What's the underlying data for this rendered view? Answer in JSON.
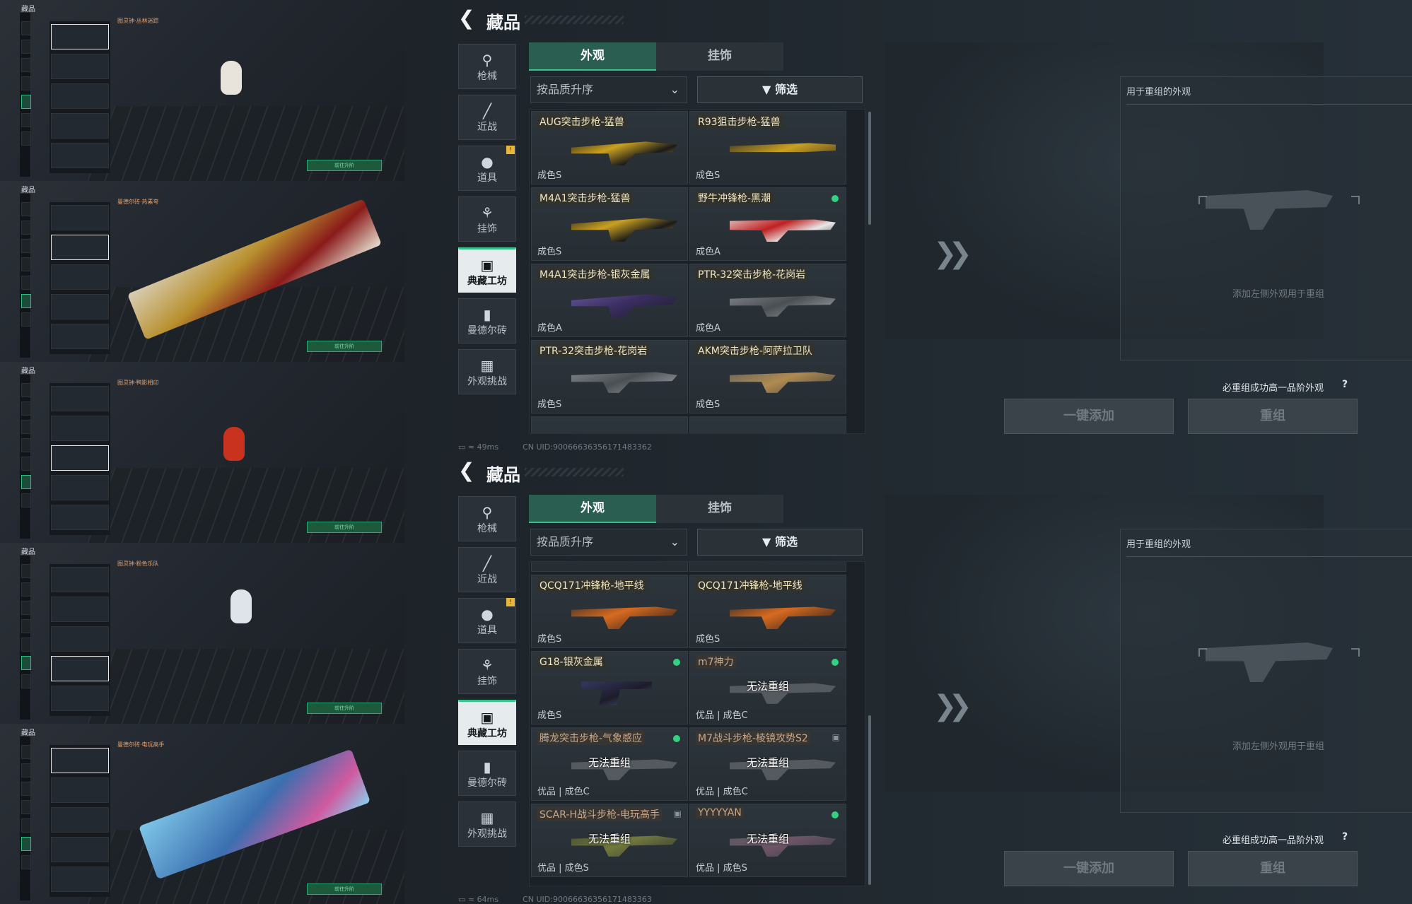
{
  "thumbs": [
    {
      "header": "藏品",
      "title": "图灵钟·丛林迷踪",
      "go": "前往升阶"
    },
    {
      "header": "藏品",
      "title": "曼德尔砖·热素夸",
      "go": "前往升阶"
    },
    {
      "header": "藏品",
      "title": "图灵钟·鸭影相印",
      "go": "前往升阶"
    },
    {
      "header": "藏品",
      "title": "图灵钟·粉色乐队",
      "go": "前往升阶"
    },
    {
      "header": "藏品",
      "title": "曼德尔砖·电玩高手",
      "go": "前往升阶"
    }
  ],
  "screens": [
    {
      "title": "藏品",
      "categories": [
        "枪械",
        "近战",
        "道具",
        "挂饰",
        "典藏工坊",
        "曼德尔砖",
        "外观挑战"
      ],
      "active_category": "典藏工坊",
      "tabs": [
        "外观",
        "挂饰"
      ],
      "sort_label": "按品质升序",
      "filter_label": "筛选",
      "items": [
        {
          "name": "AUG突击步枪-猛兽",
          "grade": "成色S",
          "dot": false,
          "lock": false,
          "unavailable": ""
        },
        {
          "name": "R93狙击步枪-猛兽",
          "grade": "成色S",
          "dot": false,
          "lock": false,
          "unavailable": ""
        },
        {
          "name": "M4A1突击步枪-猛兽",
          "grade": "成色S",
          "dot": false,
          "lock": false,
          "unavailable": ""
        },
        {
          "name": "野牛冲锋枪-黑潮",
          "grade": "成色A",
          "dot": true,
          "lock": false,
          "unavailable": ""
        },
        {
          "name": "M4A1突击步枪-银灰金属",
          "grade": "成色A",
          "dot": false,
          "lock": false,
          "unavailable": ""
        },
        {
          "name": "PTR-32突击步枪-花岗岩",
          "grade": "成色A",
          "dot": false,
          "lock": false,
          "unavailable": ""
        },
        {
          "name": "PTR-32突击步枪-花岗岩",
          "grade": "成色S",
          "dot": false,
          "lock": false,
          "unavailable": ""
        },
        {
          "name": "AKM突击步枪-阿萨拉卫队",
          "grade": "成色S",
          "dot": false,
          "lock": false,
          "unavailable": ""
        }
      ],
      "recombine_header": "用于重组的外观",
      "recombine_placeholder": "添加左侧外观用于重组",
      "hint": "必重组成功高一品阶外观",
      "hint_q": "?",
      "btn_add": "一键添加",
      "btn_recombine": "重组",
      "ping": "49ms",
      "uid": "CN UID:9006663635617148336​2"
    },
    {
      "title": "藏品",
      "categories": [
        "枪械",
        "近战",
        "道具",
        "挂饰",
        "典藏工坊",
        "曼德尔砖",
        "外观挑战"
      ],
      "active_category": "典藏工坊",
      "tabs": [
        "外观",
        "挂饰"
      ],
      "sort_label": "按品质升序",
      "filter_label": "筛选",
      "items": [
        {
          "name": "QCQ171冲锋枪-地平线",
          "grade": "成色S",
          "dot": false,
          "lock": false,
          "unavailable": ""
        },
        {
          "name": "QCQ171冲锋枪-地平线",
          "grade": "成色S",
          "dot": false,
          "lock": false,
          "unavailable": ""
        },
        {
          "name": "G18-银灰金属",
          "grade": "成色S",
          "dot": true,
          "lock": false,
          "unavailable": ""
        },
        {
          "name": "m7神力",
          "grade": "优品 | 成色C",
          "dot": true,
          "lock": false,
          "unavailable": "无法重组"
        },
        {
          "name": "腾龙突击步枪-气象感应",
          "grade": "优品 | 成色C",
          "dot": true,
          "lock": false,
          "unavailable": "无法重组"
        },
        {
          "name": "M7战斗步枪-棱镜攻势S2",
          "grade": "优品 | 成色C",
          "dot": false,
          "lock": true,
          "unavailable": "无法重组"
        },
        {
          "name": "SCAR-H战斗步枪-电玩高手",
          "grade": "优品 | 成色S",
          "dot": false,
          "lock": true,
          "unavailable": "无法重组"
        },
        {
          "name": "YYYYYAN",
          "grade": "优品 | 成色S",
          "dot": true,
          "lock": false,
          "unavailable": "无法重组"
        }
      ],
      "recombine_header": "用于重组的外观",
      "recombine_placeholder": "添加左侧外观用于重组",
      "hint": "必重组成功高一品阶外观",
      "hint_q": "?",
      "btn_add": "一键添加",
      "btn_recombine": "重组",
      "ping": "64ms",
      "uid": "CN UID:9006663635617148336​3"
    }
  ],
  "colors": {
    "accent": "#34c48a",
    "badge": "#e9b53c",
    "dot": "#34d17f"
  },
  "icons": {
    "categories": [
      "pistol-icon",
      "knife-icon",
      "grenade-icon",
      "charm-icon",
      "workshop-icon",
      "brick-icon",
      "challenge-icon"
    ]
  }
}
